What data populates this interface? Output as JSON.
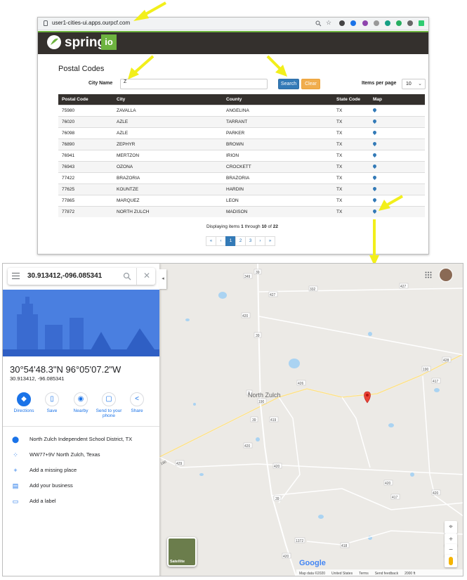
{
  "browser": {
    "url": "user1-cities-ui.apps.ourpcf.com"
  },
  "app": {
    "logo_text": "spring",
    "logo_badge": "io"
  },
  "search_form": {
    "title": "Postal Codes",
    "city_label": "City Name",
    "city_value": "Z",
    "search_label": "Search",
    "clear_label": "Clear",
    "items_per_page_label": "Items per page",
    "items_per_page_value": "10"
  },
  "table": {
    "headers": [
      "Postal Code",
      "City",
      "County",
      "State Code",
      "Map"
    ],
    "rows": [
      [
        "75980",
        "ZAVALLA",
        "ANGELINA",
        "TX"
      ],
      [
        "76020",
        "AZLE",
        "TARRANT",
        "TX"
      ],
      [
        "76098",
        "AZLE",
        "PARKER",
        "TX"
      ],
      [
        "76890",
        "ZEPHYR",
        "BROWN",
        "TX"
      ],
      [
        "76941",
        "MERTZON",
        "IRION",
        "TX"
      ],
      [
        "76943",
        "OZONA",
        "CROCKETT",
        "TX"
      ],
      [
        "77422",
        "BRAZORIA",
        "BRAZORIA",
        "TX"
      ],
      [
        "77625",
        "KOUNTZE",
        "HARDIN",
        "TX"
      ],
      [
        "77865",
        "MARQUEZ",
        "LEON",
        "TX"
      ],
      [
        "77872",
        "NORTH ZULCH",
        "MADISON",
        "TX"
      ]
    ]
  },
  "paging": {
    "prefix": "Displaying items ",
    "from": "1",
    "middle": " through ",
    "to": "10",
    "of": " of ",
    "total": "22",
    "buttons": [
      "«",
      "‹",
      "1",
      "2",
      "3",
      "›",
      "»"
    ],
    "active_page": "1"
  },
  "maps": {
    "search_value": "30.913412,-096.085341",
    "place_title": "30°54'48.3\"N 96°05'07.2\"W",
    "place_subtitle": "30.913412, -96.085341",
    "actions": {
      "directions": "Directions",
      "save": "Save",
      "nearby": "Nearby",
      "send_line1": "Send to your",
      "send_line2": "phone",
      "share": "Share"
    },
    "info": {
      "school": "North Zulch Independent School District, TX",
      "plus_code": "WW77+9V North Zulch, Texas",
      "add_place": "Add a missing place",
      "add_business": "Add your business",
      "add_label": "Add a label"
    },
    "town_label": "North Zulch",
    "road_labels": {
      "r39a": "39",
      "r349": "349",
      "r427": "427",
      "r332": "332",
      "r427b": "427",
      "r420": "420",
      "r39b": "39",
      "r428": "428",
      "r190": "190",
      "r417": "417",
      "r426": "426",
      "r2": "2",
      "r190b": "190",
      "r39c": "39",
      "r419": "419",
      "r420b": "420",
      "r420c": "420",
      "r429": "429",
      "r420d": "420",
      "r417b": "417",
      "r420e": "420",
      "r39d": "39",
      "r1372": "1372",
      "r418": "418",
      "r190c": "190",
      "r420f": "420"
    },
    "satellite_label": "Satellite",
    "google_logo": "Google",
    "footer": {
      "map_data": "Map data ©2020",
      "country": "United States",
      "terms": "Terms",
      "feedback": "Send feedback",
      "scale": "2000 ft"
    }
  },
  "colors": {
    "arrow": "#f2ef1b",
    "spring_green": "#6db33f",
    "bootstrap_blue": "#337ab7",
    "map_pin": "#ea4335",
    "google_blue": "#1a73e8"
  }
}
